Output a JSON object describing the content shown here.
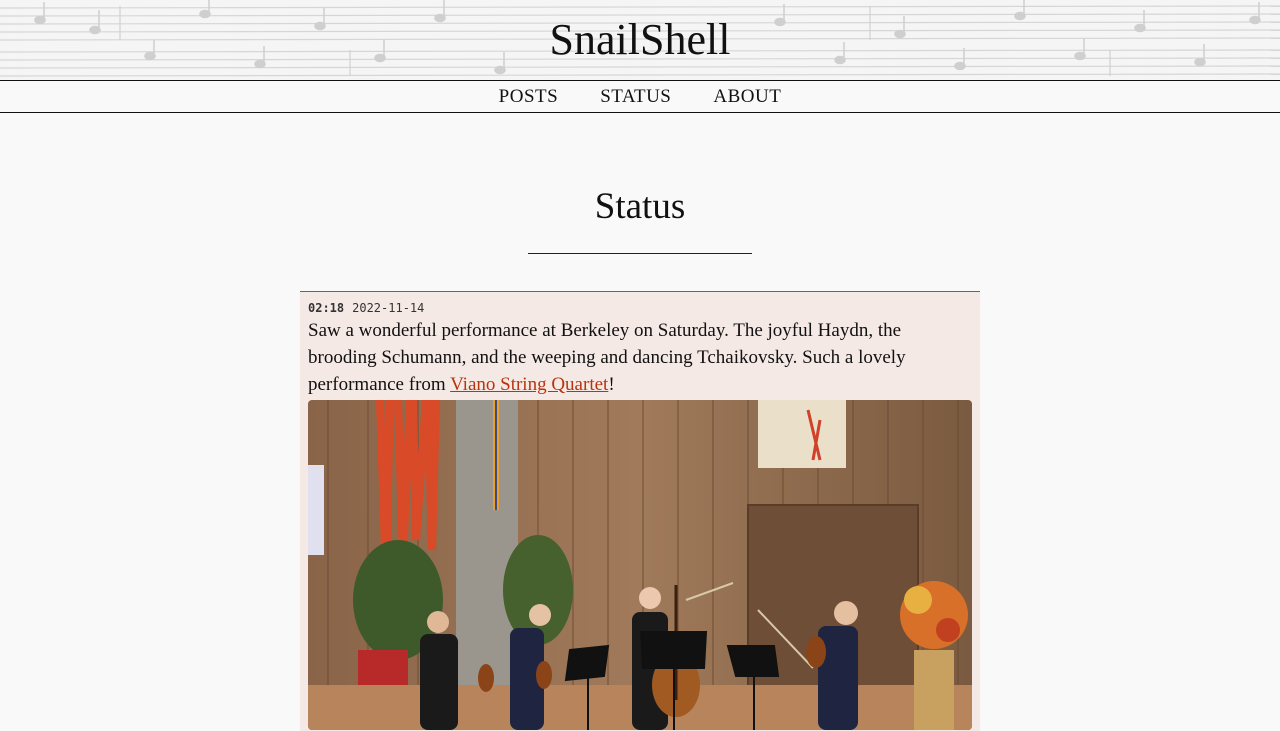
{
  "site": {
    "title": "SnailShell"
  },
  "nav": {
    "items": [
      {
        "label": "POSTS"
      },
      {
        "label": "STATUS"
      },
      {
        "label": "ABOUT"
      }
    ]
  },
  "page": {
    "heading": "Status"
  },
  "status": {
    "time": "02:18",
    "date": "2022-11-14",
    "text_before": "Saw a wonderful performance at Berkeley on Saturday. The joyful Haydn, the brooding Schumann, and the weeping and dancing Tchaikovsky. Such a lovely performance from ",
    "link_text": "Viano String Quartet",
    "text_after": "!",
    "photo_icon": "concert-photo"
  },
  "colors": {
    "accent_link": "#b8340f",
    "card_background": "#f5e9e6",
    "card_border": "#a0522d",
    "page_background": "#f9f9f9"
  }
}
